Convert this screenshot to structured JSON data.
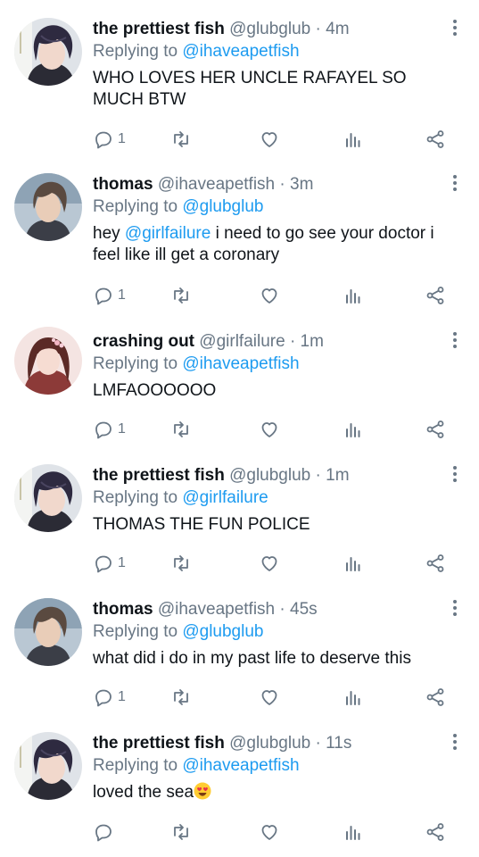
{
  "tweets": [
    {
      "display_name": "the prettiest fish",
      "handle": "@glubglub",
      "time": "· 4m",
      "replying_label": "Replying to",
      "replying_to": "@ihaveapetfish",
      "text": "WHO LOVES HER UNCLE RAFAYEL SO MUCH BTW",
      "reply_count": "1",
      "avatar": "avatar-fish"
    },
    {
      "display_name": "thomas",
      "handle": "@ihaveapetfish",
      "time": "· 3m",
      "replying_label": "Replying to",
      "replying_to": "@glubglub",
      "text_prefix": "hey ",
      "text_mention": "@girlfailure",
      "text_suffix": " i need to go see your doctor i feel like ill get a coronary",
      "reply_count": "1",
      "avatar": "avatar-thomas"
    },
    {
      "display_name": "crashing out",
      "handle": "@girlfailure",
      "time": "· 1m",
      "replying_label": "Replying to",
      "replying_to": "@ihaveapetfish",
      "text": "LMFAOOOOOO",
      "reply_count": "1",
      "avatar": "avatar-girl"
    },
    {
      "display_name": "the prettiest fish",
      "handle": "@glubglub",
      "time": "· 1m",
      "replying_label": "Replying to",
      "replying_to": "@girlfailure",
      "text": "THOMAS THE FUN POLICE",
      "reply_count": "1",
      "avatar": "avatar-fish"
    },
    {
      "display_name": "thomas",
      "handle": "@ihaveapetfish",
      "time": "· 45s",
      "replying_label": "Replying to",
      "replying_to": "@glubglub",
      "text": "what did i do in my past life to deserve this",
      "reply_count": "1",
      "avatar": "avatar-thomas"
    },
    {
      "display_name": "the prettiest fish",
      "handle": "@glubglub",
      "time": "· 11s",
      "replying_label": "Replying to",
      "replying_to": "@ihaveapetfish",
      "text": "loved the sea",
      "emoji": "heart-eyes-emoji",
      "reply_count": "",
      "avatar": "avatar-fish"
    }
  ],
  "icons": {
    "reply": "reply-icon",
    "retweet": "retweet-icon",
    "like": "heart-icon",
    "views": "analytics-icon",
    "share": "share-icon",
    "more": "more-vertical-icon"
  },
  "colors": {
    "link": "#1d9bf0",
    "muted": "#687684",
    "text": "#0f1419"
  }
}
